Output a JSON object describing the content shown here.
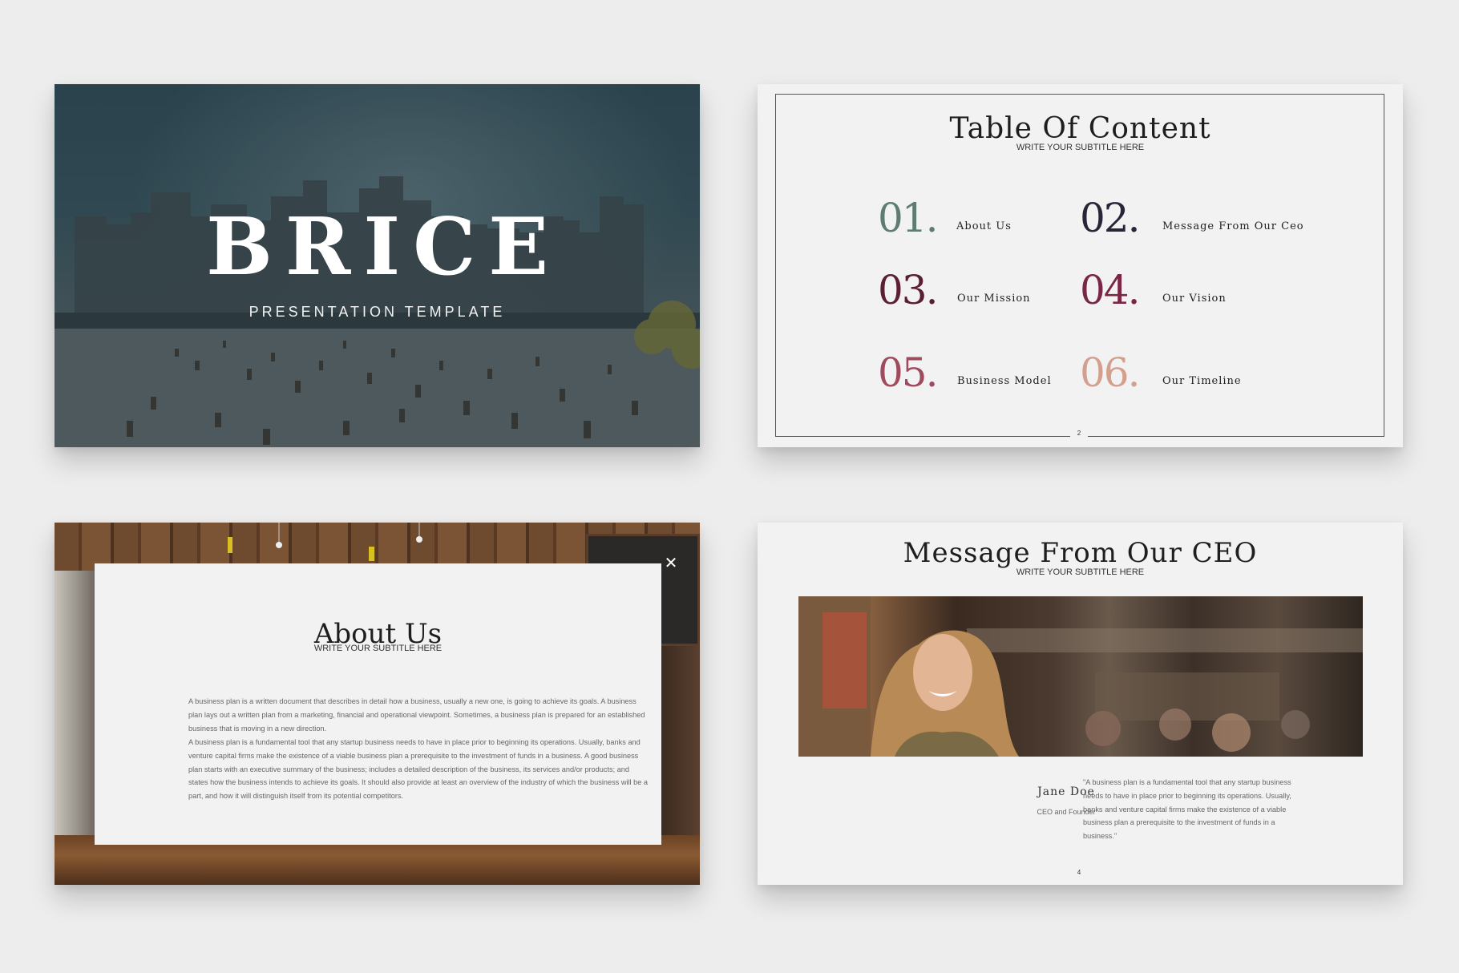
{
  "cover": {
    "title": "BRICE",
    "subtitle": "PRESENTATION TEMPLATE"
  },
  "toc": {
    "title": "Table Of Content",
    "subtitle": "WRITE YOUR SUBTITLE HERE",
    "page_number": "2",
    "items": [
      {
        "number": "01.",
        "label": "About Us",
        "color": "#5e7b74"
      },
      {
        "number": "02.",
        "label": "Message From Our Ceo",
        "color": "#2a2536"
      },
      {
        "number": "03.",
        "label": "Our Mission",
        "color": "#5a1f35"
      },
      {
        "number": "04.",
        "label": "Our Vision",
        "color": "#7a2747"
      },
      {
        "number": "05.",
        "label": "Business Model",
        "color": "#a04a5e"
      },
      {
        "number": "06.",
        "label": "Our Timeline",
        "color": "#d4a08e"
      }
    ]
  },
  "about": {
    "title": "About Us",
    "subtitle": "WRITE YOUR SUBTITLE HERE",
    "paragraph_1": "A business plan is a written document that describes in detail how a business, usually a new one, is going to achieve its goals. A business plan lays out a written plan from a marketing, financial and operational viewpoint. Sometimes, a business plan is prepared for an established business that is moving in a new direction.",
    "paragraph_2": "A business plan is a fundamental tool that any startup business needs to have in place prior to beginning its operations. Usually, banks and venture capital firms make the existence of a viable business plan a prerequisite to the investment of funds in a business. A good business plan starts with an executive summary of the business; includes a detailed description of the business, its services and/or products; and states how the business intends to achieve its goals. It should also provide at least an overview of the industry of which the business will be a part, and how it will distinguish itself from its potential competitors."
  },
  "ceo": {
    "title": "Message From Our CEO",
    "subtitle": "WRITE YOUR SUBTITLE HERE",
    "name": "Jane Doe",
    "role": "CEO and Founder",
    "quote": "\"A business plan is a fundamental tool that any startup business needs to have in place prior to beginning its operations. Usually, banks and venture capital firms make the existence of a viable business plan a prerequisite to the investment of funds in a business.\"",
    "page_number": "4"
  }
}
